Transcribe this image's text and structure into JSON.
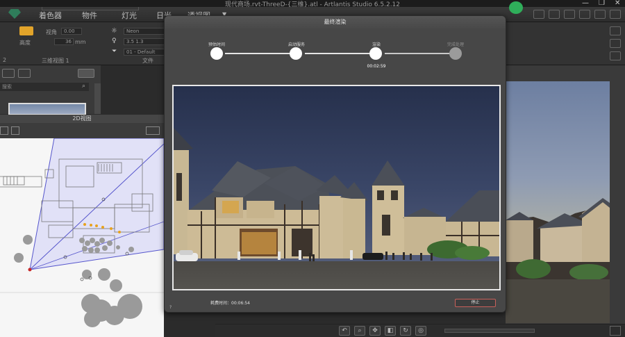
{
  "window": {
    "title": "现代商场.rvt-ThreeD-{三维}.atl - Artlantis Studio 6.5.2.12",
    "minimize": "—",
    "maximize": "❐",
    "close": "✕"
  },
  "menu": {
    "items": [
      "着色器",
      "物件",
      "灯光",
      "日光",
      "透视图"
    ],
    "arrow": "▼"
  },
  "props": {
    "focal_label": "视角",
    "focal_value": "0.00",
    "height_label": "高度",
    "height_value": "36",
    "height_unit": "mm",
    "neon_value": "Neon",
    "row2_value": "3.5 1.3",
    "row3_value": "01 - Default",
    "left_section": "三维视图 1",
    "mid_section": "文件",
    "num2": "2"
  },
  "left_panel": {
    "search_placeholder": "搜索",
    "plan_title": "2D视图"
  },
  "dialog": {
    "title": "最终渲染",
    "steps": [
      {
        "label": "预估时间",
        "state": "done"
      },
      {
        "label": "启动服务",
        "state": "done"
      },
      {
        "label": "渲染",
        "state": "active"
      },
      {
        "label": "完成处理",
        "state": "pending"
      }
    ],
    "step_time": "00:02:59",
    "elapsed": "耗费时间：00:06:54",
    "stop": "停止",
    "corner": "?"
  },
  "colors": {
    "accent": "#e2a42a",
    "brand": "#2f7d5b",
    "stop_border": "#c9605a",
    "camera": "#c62828",
    "path_dot": "#e8a21c"
  },
  "icons": [
    "gem-logo-icon",
    "camera-icon",
    "sun-icon",
    "lightbulb-icon",
    "search-icon",
    "eye-icon",
    "print-icon",
    "home-icon",
    "undo-icon",
    "zoom-icon",
    "pan-icon",
    "refresh-icon",
    "settings-icon"
  ]
}
